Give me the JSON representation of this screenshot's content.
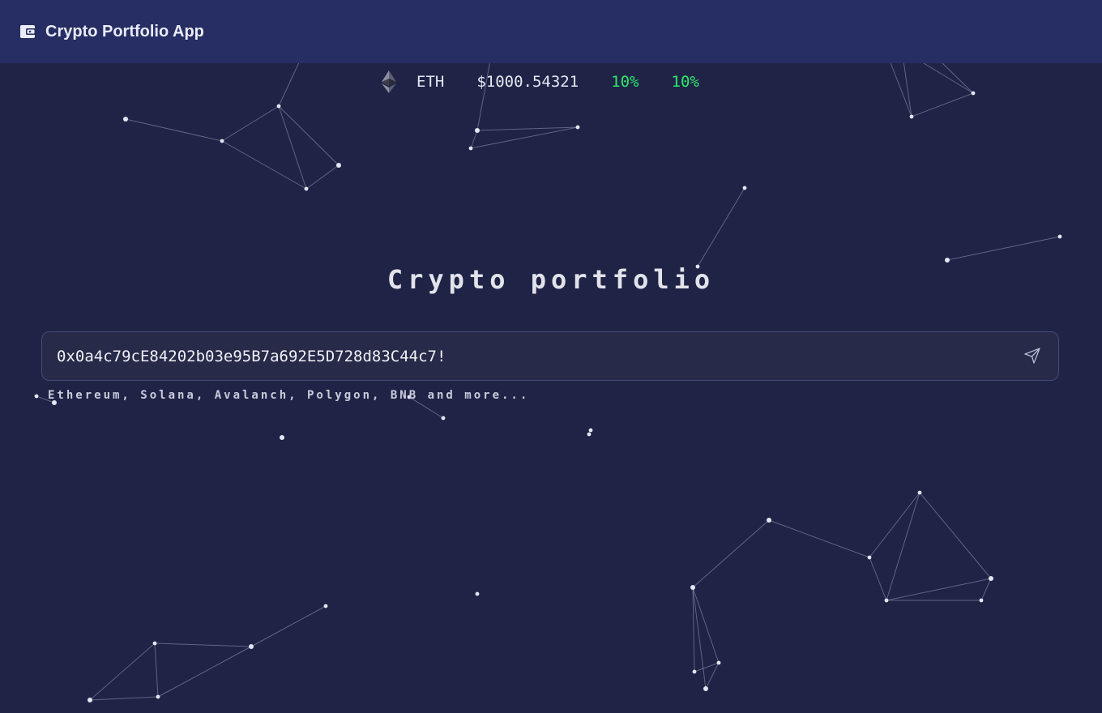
{
  "header": {
    "title": "Crypto Portfolio App",
    "icon": "wallet-icon"
  },
  "ticker": {
    "icon": "ethereum-icon",
    "symbol": "ETH",
    "price": "$1000.54321",
    "change_1": "10%",
    "change_2": "10%"
  },
  "main": {
    "title": "Crypto portfolio",
    "search": {
      "value": "0x0a4c79cE84202b03e95B7a692E5D728d83C44c7!",
      "submit_icon": "send-icon"
    },
    "chains_text": "Ethereum, Solana, Avalanch, Polygon, BNB and more..."
  },
  "colors": {
    "background": "#1f2447",
    "header": "#262e63",
    "positive": "#2ee86b",
    "input_bg": "#272a48"
  }
}
